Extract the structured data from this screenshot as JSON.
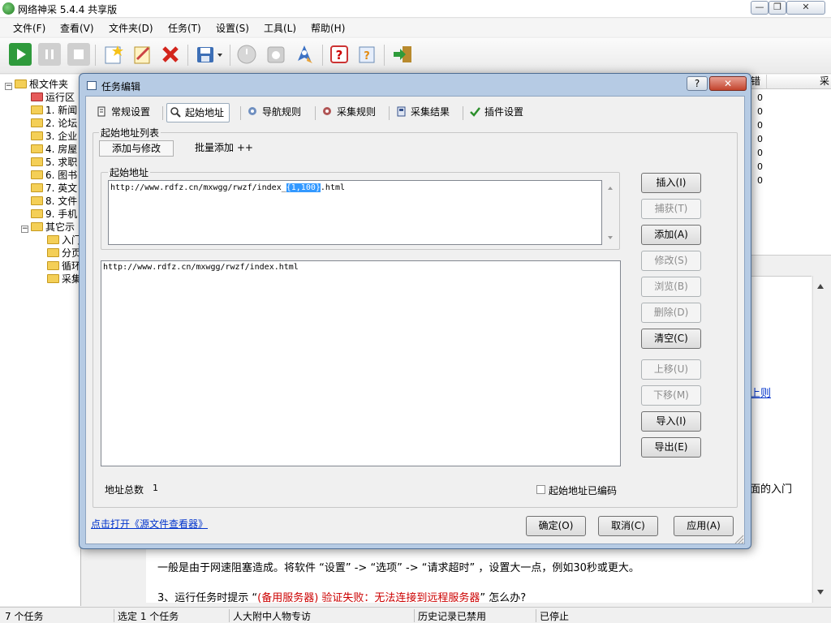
{
  "window": {
    "title": "网络神采 5.4.4 共享版",
    "minimize": "—",
    "maximize": "❐",
    "close": "✕"
  },
  "menu": [
    "文件(F)",
    "查看(V)",
    "文件夹(D)",
    "任务(T)",
    "设置(S)",
    "工具(L)",
    "帮助(H)"
  ],
  "toolbar": {
    "icons": [
      "play-icon",
      "pause-icon",
      "stop-icon",
      "new-task-icon",
      "edit-task-icon",
      "delete-task-icon",
      "save-icon",
      "dropdown-arrow-icon",
      "timer-icon",
      "export-icon",
      "launch-icon",
      "help-icon",
      "hint-icon",
      "exit-icon"
    ]
  },
  "tree": {
    "root": "根文件夹",
    "items": [
      {
        "label": "运行区",
        "red": true
      },
      {
        "label": "1. 新闻"
      },
      {
        "label": "2. 论坛"
      },
      {
        "label": "3. 企业"
      },
      {
        "label": "4. 房屋"
      },
      {
        "label": "5. 求职"
      },
      {
        "label": "6. 图书"
      },
      {
        "label": "7. 英文"
      },
      {
        "label": "8. 文件"
      },
      {
        "label": "9. 手机"
      }
    ],
    "other": "其它示",
    "other_items": [
      "入门",
      "分页",
      "循环",
      "采集"
    ]
  },
  "grid": {
    "error_col": "错",
    "last_col": "采",
    "error_counts": [
      "0",
      "0",
      "0",
      "0",
      "0",
      "0",
      "0"
    ]
  },
  "doc": {
    "link_fragment": "上则",
    "fragment2": "面的入门",
    "line1": "一般是由于网速阻塞造成。将软件 “设置” -> “选项” -> “请求超时” ，设置大一点，例如30秒或更大。",
    "line2_prefix": "3、运行任务时提示 “",
    "line2_red": "(备用服务器) 验证失败：无法连接到远程服务器",
    "line2_suffix": "” 怎么办?"
  },
  "status": {
    "tasks": "7 个任务",
    "selected": "选定 1 个任务",
    "current": "人大附中人物专访",
    "history": "历史记录已禁用",
    "state": "已停止"
  },
  "dialog": {
    "title": "任务编辑",
    "help": "?",
    "close": "✕",
    "tabs": [
      {
        "label": "常规设置",
        "icon": "settings-icon"
      },
      {
        "label": "起始地址",
        "icon": "magnifier-icon"
      },
      {
        "label": "导航规则",
        "icon": "navigation-icon"
      },
      {
        "label": "采集规则",
        "icon": "collect-rule-icon"
      },
      {
        "label": "采集结果",
        "icon": "result-icon"
      },
      {
        "label": "插件设置",
        "icon": "checkmark-icon"
      }
    ],
    "group_title": "起始地址列表",
    "subtabs": [
      "添加与修改",
      "批量添加 ++"
    ],
    "start_url_label": "起始地址",
    "url_input": {
      "prefix": "http://www.rdfz.cn/mxwgg/rwzf/index_",
      "selected": "{1,100}",
      "suffix": ".html"
    },
    "url_list": [
      "http://www.rdfz.cn/mxwgg/rwzf/index.html"
    ],
    "buttons": {
      "insert": "插入(I)",
      "capture": "捕获(T)",
      "add": "添加(A)",
      "modify": "修改(S)",
      "browse": "浏览(B)",
      "delete": "删除(D)",
      "clear": "清空(C)",
      "up": "上移(U)",
      "down": "下移(M)",
      "import": "导入(I)",
      "export": "导出(E)"
    },
    "total_label": "地址总数",
    "total_value": "1",
    "encoded_label": "起始地址已编码",
    "source_link": "点击打开《源文件查看器》",
    "ok": "确定(O)",
    "cancel": "取消(C)",
    "apply": "应用(A)"
  }
}
